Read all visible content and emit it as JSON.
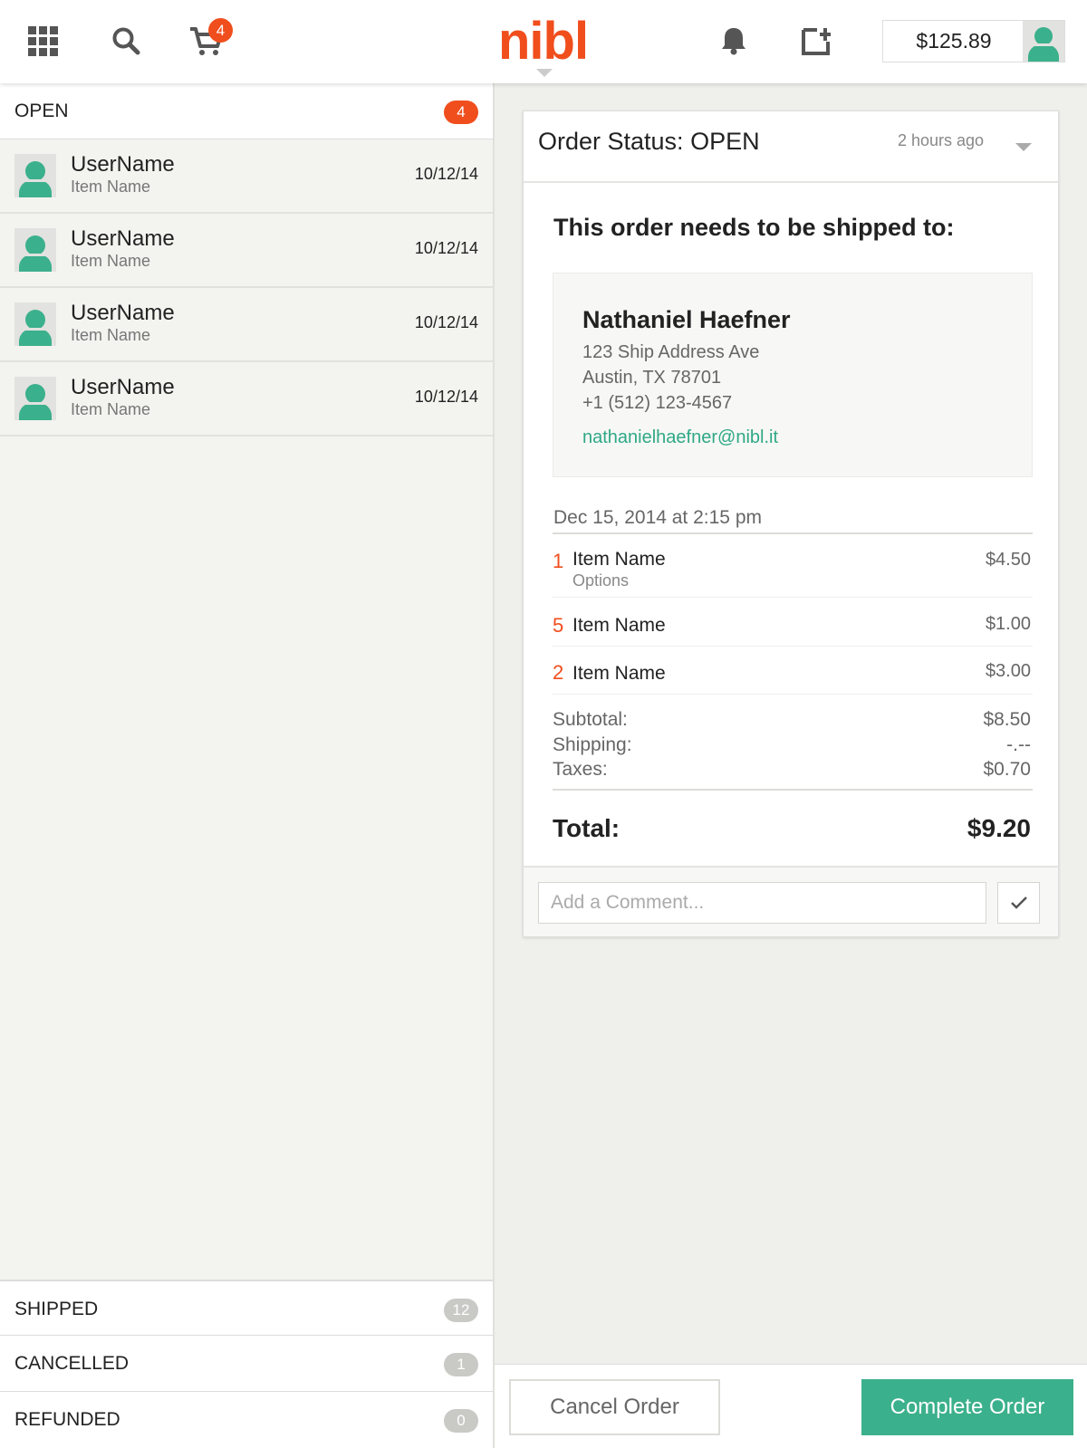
{
  "header": {
    "logo": "nibl",
    "cart_count": "4",
    "balance": "$125.89",
    "icons": [
      "apps-grid-icon",
      "search-icon",
      "cart-icon",
      "bell-icon",
      "add-listing-icon"
    ]
  },
  "sidebar": {
    "open": {
      "label": "OPEN",
      "count": "4"
    },
    "orders": [
      {
        "user": "UserName",
        "item": "Item Name",
        "date": "10/12/14"
      },
      {
        "user": "UserName",
        "item": "Item Name",
        "date": "10/12/14"
      },
      {
        "user": "UserName",
        "item": "Item Name",
        "date": "10/12/14"
      },
      {
        "user": "UserName",
        "item": "Item Name",
        "date": "10/12/14"
      }
    ],
    "shipped": {
      "label": "SHIPPED",
      "count": "12"
    },
    "cancelled": {
      "label": "CANCELLED",
      "count": "1"
    },
    "refunded": {
      "label": "REFUNDED",
      "count": "0"
    }
  },
  "order": {
    "status_title": "Order Status: OPEN",
    "time_ago": "2 hours ago",
    "ship_heading": "This order needs to be shipped to:",
    "address": {
      "name": "Nathaniel Haefner",
      "street": "123 Ship Address Ave",
      "city": "Austin, TX 78701",
      "phone": "+1 (512) 123-4567",
      "email": "nathanielhaefner@nibl.it"
    },
    "date": "Dec 15, 2014 at 2:15 pm",
    "items": [
      {
        "qty": "1",
        "name": "Item Name",
        "options": "Options",
        "price": "$4.50"
      },
      {
        "qty": "5",
        "name": "Item Name",
        "price": "$1.00"
      },
      {
        "qty": "2",
        "name": "Item Name",
        "price": "$3.00"
      }
    ],
    "summary": {
      "subtotal_label": "Subtotal:",
      "subtotal": "$8.50",
      "shipping_label": "Shipping:",
      "shipping": "-.--",
      "taxes_label": "Taxes:",
      "taxes": "$0.70",
      "total_label": "Total:",
      "total": "$9.20"
    },
    "comment_placeholder": "Add a Comment..."
  },
  "actions": {
    "cancel": "Cancel Order",
    "complete": "Complete Order"
  },
  "colors": {
    "brand_orange": "#f04e1d",
    "accent_green": "#3bb08c"
  }
}
